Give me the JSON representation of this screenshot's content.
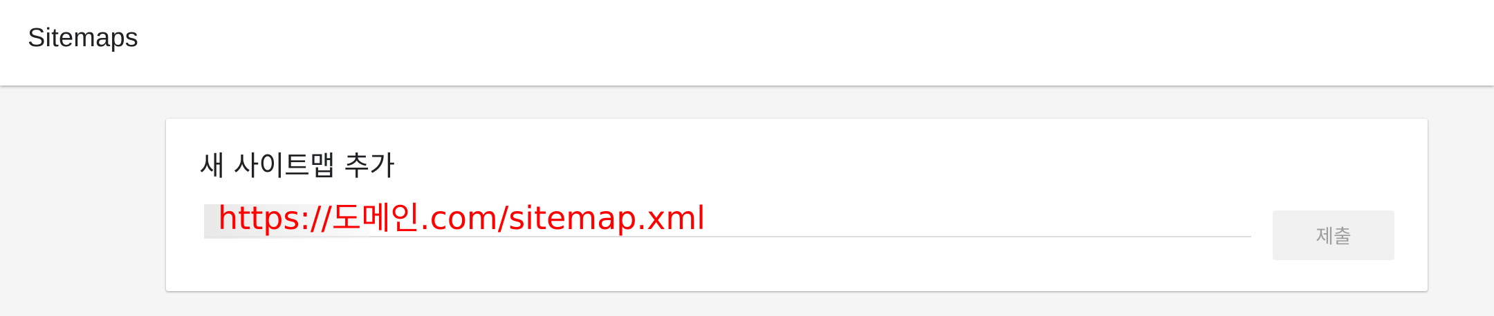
{
  "header": {
    "title": "Sitemaps"
  },
  "add_sitemap": {
    "title": "새 사이트맵 추가",
    "input_value": "https://도메인.com/sitemap.xml",
    "submit_label": "제출"
  },
  "colors": {
    "url_text": "#ff0000",
    "disabled_button_bg": "#f1f1f1",
    "disabled_button_text": "#9e9e9e"
  }
}
